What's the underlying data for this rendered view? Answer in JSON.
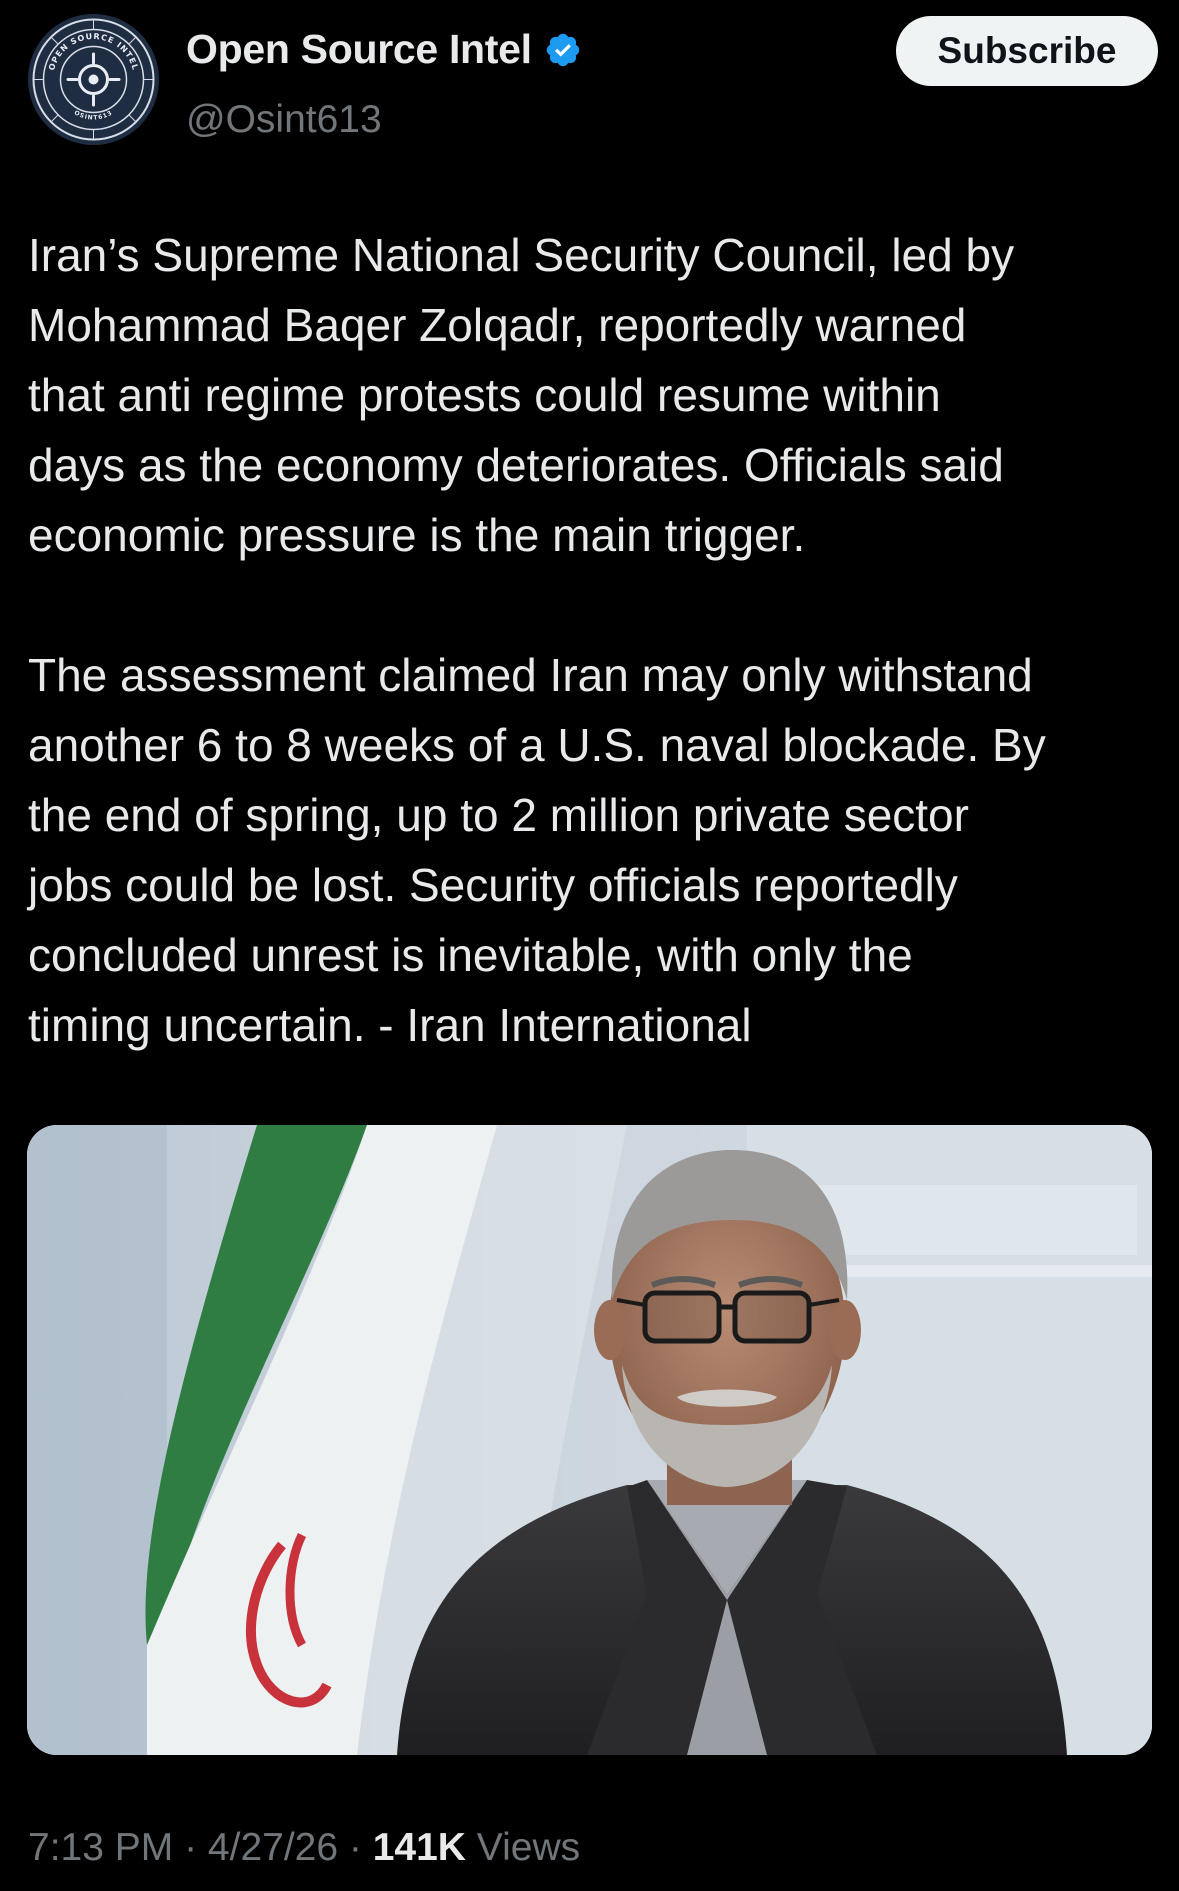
{
  "author": {
    "display_name": "Open Source Intel",
    "handle": "@Osint613",
    "avatar_text_top": "OPEN SOURCE INTEL",
    "avatar_text_bottom": "OSINT613",
    "verified_color": "#1d9bf0"
  },
  "actions": {
    "subscribe_label": "Subscribe"
  },
  "post": {
    "paragraphs": [
      "Iran’s Supreme National Security Council, led by\nMohammad Baqer Zolqadr, reportedly warned\nthat anti regime protests could resume within\ndays as the economy deteriorates. Officials said\neconomic pressure is the main trigger.",
      "The assessment claimed Iran may only withstand\nanother 6 to 8 weeks of a U.S. naval blockade. By\nthe end of spring, up to 2 million private sector\njobs could be lost. Security officials reportedly\nconcluded unrest is inevitable, with only the\ntiming uncertain. - Iran International"
    ]
  },
  "meta": {
    "time": "7:13 PM",
    "separator": " · ",
    "date": "4/27/26",
    "views_count": "141K",
    "views_label": " Views"
  },
  "colors": {
    "background": "#000000",
    "text_primary": "#e7e9ea",
    "text_secondary": "#71767b",
    "button_bg": "#eff3f4"
  }
}
